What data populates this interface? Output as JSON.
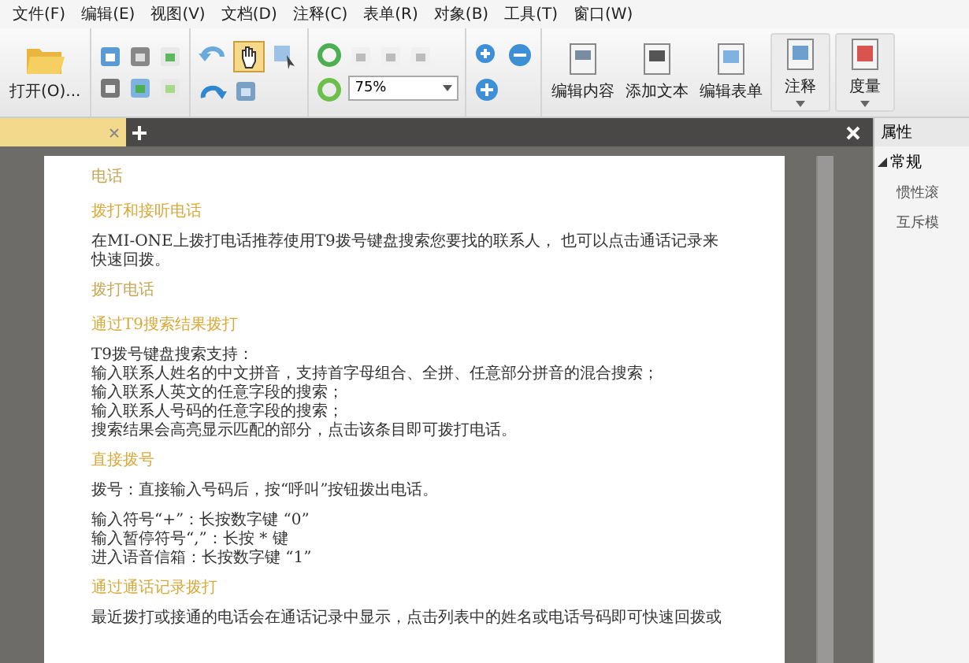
{
  "menu": [
    "文件(F)",
    "编辑(E)",
    "视图(V)",
    "文档(D)",
    "注释(C)",
    "表单(R)",
    "对象(B)",
    "工具(T)",
    "窗口(W)"
  ],
  "toolbar": {
    "open_button": {
      "label": "打开(O)..."
    },
    "hand_tool": {
      "selected": true
    },
    "select_tool": {
      "selected": false
    },
    "zoom": {
      "value": "75%"
    },
    "big_buttons": [
      {
        "label": "编辑内容",
        "kind": "plain"
      },
      {
        "label": "添加文本",
        "kind": "plain"
      },
      {
        "label": "编辑表单",
        "kind": "plain"
      },
      {
        "label": "注释",
        "kind": "dropdown"
      },
      {
        "label": "度量",
        "kind": "dropdown"
      }
    ]
  },
  "document": {
    "paragraphs": [
      {
        "kind": "heading",
        "lines": [
          "电话"
        ]
      },
      {
        "kind": "subheading",
        "lines": [
          "拨打和接听电话"
        ]
      },
      {
        "kind": "body",
        "lines": [
          "在MI-ONE上拨打电话推荐使用T9拨号键盘搜索您要找的联系人， 也可以点击通话记录来",
          "快速回拨。"
        ]
      },
      {
        "kind": "heading",
        "lines": [
          "拨打电话"
        ]
      },
      {
        "kind": "subheading",
        "lines": [
          "通过T9搜索结果拨打"
        ]
      },
      {
        "kind": "body",
        "lines": [
          "T9拨号键盘搜索支持：",
          "输入联系人姓名的中文拼音，支持首字母组合、全拼、任意部分拼音的混合搜索；",
          "输入联系人英文的任意字段的搜索；",
          "输入联系人号码的任意字段的搜索；",
          "搜索结果会高亮显示匹配的部分，点击该条目即可拨打电话。"
        ]
      },
      {
        "kind": "subheading",
        "lines": [
          "直接拨号"
        ]
      },
      {
        "kind": "body",
        "lines": [
          "拨号：直接输入号码后，按“呼叫”按钮拨出电话。"
        ]
      },
      {
        "kind": "body",
        "lines": [
          "输入符号“+”：长按数字键 “0”",
          "输入暂停符号“,”：长按 * 键",
          "进入语音信箱：长按数字键 “1”"
        ]
      },
      {
        "kind": "subheading",
        "lines": [
          "通过通话记录拨打"
        ]
      },
      {
        "kind": "body",
        "lines": [
          "最近拨打或接通的电话会在通话记录中显示，点击列表中的姓名或电话号码即可快速回拨或"
        ]
      }
    ]
  },
  "properties_panel": {
    "title": "属性",
    "group": {
      "label": "常规",
      "expanded": true,
      "items": [
        "惯性滚",
        "互斥模"
      ]
    }
  }
}
